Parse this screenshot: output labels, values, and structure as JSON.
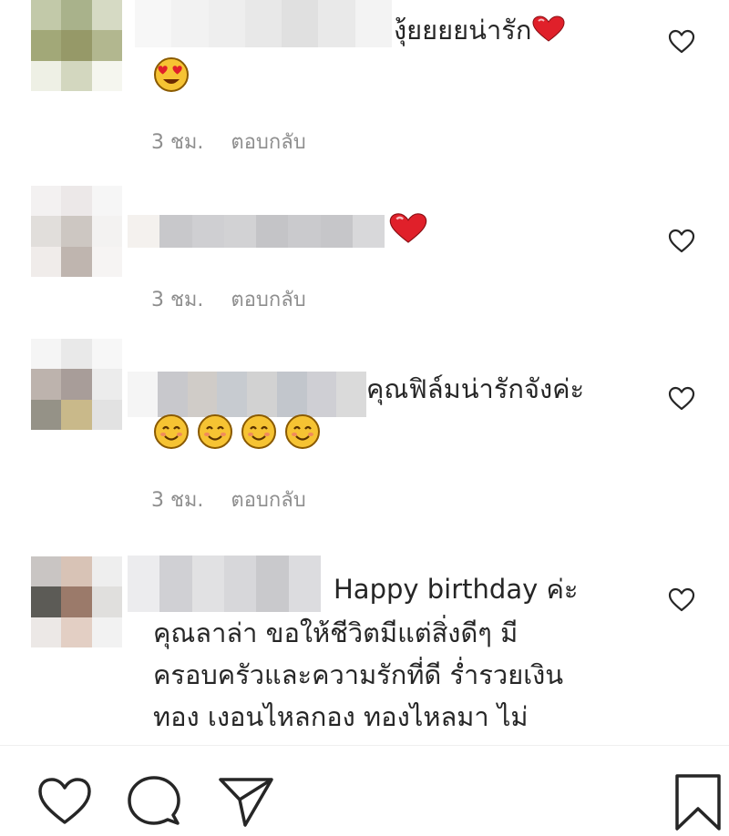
{
  "comments": [
    {
      "text_tail": "งุ้ยยยยน่ารัก",
      "text_lines": [],
      "time": "3 ชม.",
      "reply": "ตอบกลับ",
      "avatar_colors": [
        "#c2c9a9",
        "#a9b28b",
        "#d6dac4",
        "#a2a878",
        "#969968",
        "#b2b78f",
        "#eef0e5",
        "#d3d7bf",
        "#f5f6ef"
      ],
      "name_colors": [
        "#f7f7f7",
        "#f2f2f2",
        "#eeeeee",
        "#e8e8e8",
        "#e0e0e0",
        "#e9e9e9",
        "#f3f3f3"
      ],
      "emoji_icons": [
        "heart-eyes-emoji-icon"
      ]
    },
    {
      "text_tail": "",
      "text_lines": [],
      "time": "3 ชม.",
      "reply": "ตอบกลับ",
      "avatar_colors": [
        "#f3f1f1",
        "#ece8e8",
        "#f6f6f6",
        "#e1dedb",
        "#cdc7c2",
        "#f3f2f1",
        "#f0ecea",
        "#bfb5af",
        "#f6f4f3"
      ],
      "name_colors": [
        "#f4f1ee",
        "#c8c8cb",
        "#cfcfd2",
        "#d2d2d4",
        "#c4c4c7",
        "#cacacd",
        "#c6c6c9",
        "#d8d8da"
      ],
      "emoji_icons": []
    },
    {
      "text_tail": "คุณฟิล์มน่ารักจังค่ะ",
      "text_lines": [],
      "time": "3 ชม.",
      "reply": "ตอบกลับ",
      "avatar_colors": [
        "#f5f5f5",
        "#e9e9e9",
        "#f7f7f7",
        "#bdb3ad",
        "#a89d99",
        "#ececec",
        "#959287",
        "#c9b98a",
        "#e2e2e2"
      ],
      "name_colors": [
        "#f5f5f5",
        "#c8c8cc",
        "#d0ccc8",
        "#c7cbd0",
        "#d2d2d2",
        "#c2c6cc",
        "#cfcfd4",
        "#dadada"
      ],
      "emoji_icons": [
        "smile-emoji-icon",
        "smile-emoji-icon",
        "smile-emoji-icon",
        "smile-emoji-icon"
      ]
    },
    {
      "text_tail": "Happy birthday ค่ะ",
      "text_lines": [
        "คุณลาล่า ขอให้ชีวิตมีแต่สิ่งดีๆ มี",
        "ครอบครัวและความรักที่ดี ร่ำรวยเงิน",
        "ทอง เงอนไหลกอง ทองไหลมา ไม่"
      ],
      "time": "",
      "reply": "",
      "avatar_colors": [
        "#c9c5c3",
        "#d8c3b6",
        "#eeeeee",
        "#5c5b56",
        "#9b7a6a",
        "#e0dfdd",
        "#ece8e6",
        "#e3cfc4",
        "#f2f2f2"
      ],
      "name_colors": [
        "#ececee",
        "#d0d0d4",
        "#e1e1e3",
        "#d7d7da",
        "#c9c9cc",
        "#dcdcdf"
      ],
      "emoji_icons": []
    }
  ],
  "actions": [
    "heart-outline-icon",
    "comment-bubble-icon",
    "share-paper-plane-icon",
    "bookmark-icon"
  ],
  "colors": {
    "text": "#262626",
    "meta": "#8e8e8e",
    "heart_red": "#e0202a"
  }
}
